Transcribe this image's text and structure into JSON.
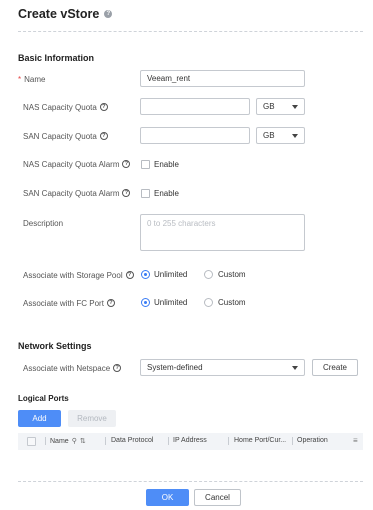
{
  "header": {
    "title": "Create vStore",
    "help_glyph": "?"
  },
  "basic_info": {
    "section_title": "Basic Information",
    "name": {
      "label": "Name",
      "required_mark": "*",
      "value": "Veeam_rent"
    },
    "nas_quota": {
      "label": "NAS Capacity Quota",
      "unit": "GB"
    },
    "san_quota": {
      "label": "SAN Capacity Quota",
      "unit": "GB"
    },
    "nas_alarm": {
      "label": "NAS Capacity Quota Alarm",
      "option": "Enable"
    },
    "san_alarm": {
      "label": "SAN Capacity Quota Alarm",
      "option": "Enable"
    },
    "description": {
      "label": "Description",
      "placeholder": "0 to 255 characters"
    },
    "storage_pool": {
      "label": "Associate with Storage Pool",
      "option_a": "Unlimited",
      "option_b": "Custom",
      "selected": "Unlimited"
    },
    "fc_port": {
      "label": "Associate with FC Port",
      "option_a": "Unlimited",
      "option_b": "Custom",
      "selected": "Unlimited"
    }
  },
  "network": {
    "section_title": "Network Settings",
    "netspace": {
      "label": "Associate with Netspace",
      "value": "System-defined",
      "create_label": "Create"
    }
  },
  "logical_ports": {
    "section_title": "Logical Ports",
    "add_label": "Add",
    "remove_label": "Remove",
    "columns": [
      "Name",
      "Data Protocol",
      "IP Address",
      "Home Port/Cur...",
      "Operation"
    ]
  },
  "footer": {
    "ok_label": "OK",
    "cancel_label": "Cancel"
  },
  "colors": {
    "accent": "#4e8df7",
    "required": "#e54545"
  },
  "icons": [
    "help-icon",
    "question-icon",
    "chevron-down-icon",
    "search-icon",
    "filter-icon",
    "settings-icon"
  ]
}
